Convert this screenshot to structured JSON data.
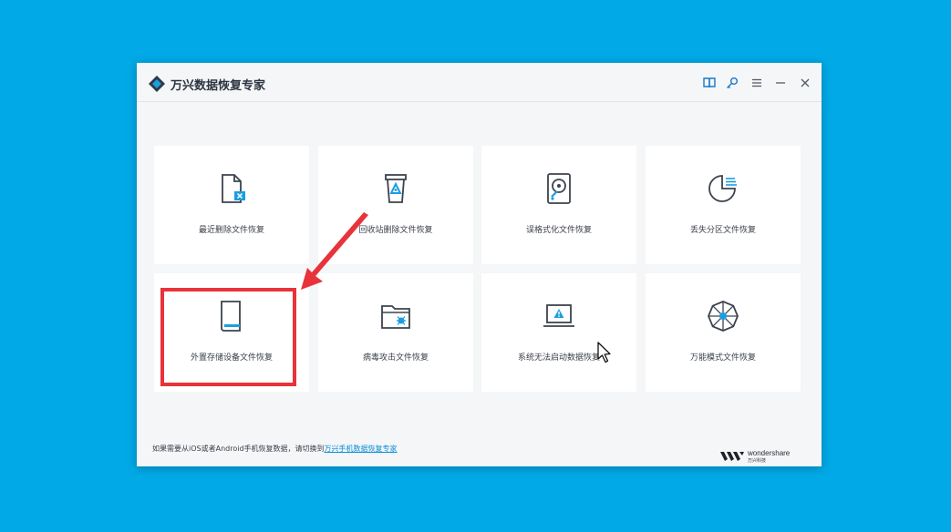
{
  "app": {
    "title": "万兴数据恢复专家"
  },
  "toolbar": {
    "help_icon": "book-icon",
    "key_icon": "key-icon",
    "menu_icon": "menu-icon",
    "minimize_icon": "minimize-icon",
    "close_icon": "close-icon"
  },
  "tiles": [
    {
      "label": "最近删除文件恢复",
      "icon": "deleted-file-icon"
    },
    {
      "label": "回收站删除文件恢复",
      "icon": "recycle-bin-icon"
    },
    {
      "label": "误格式化文件恢复",
      "icon": "hard-drive-icon"
    },
    {
      "label": "丢失分区文件恢复",
      "icon": "partition-icon"
    },
    {
      "label": "外置存储设备文件恢复",
      "icon": "external-drive-icon"
    },
    {
      "label": "病毒攻击文件恢复",
      "icon": "virus-folder-icon"
    },
    {
      "label": "系统无法启动数据恢复",
      "icon": "system-crash-icon"
    },
    {
      "label": "万能模式文件恢复",
      "icon": "all-around-icon"
    }
  ],
  "footer": {
    "text": "如果需要从iOS或者Android手机恢复数据，请切换到",
    "link": "万兴手机数据恢复专家"
  },
  "brand": {
    "name": "wondershare",
    "sub": "万兴科技"
  },
  "colors": {
    "background": "#01a9e6",
    "accent": "#1a9ee0",
    "annotation": "#e8333a"
  }
}
